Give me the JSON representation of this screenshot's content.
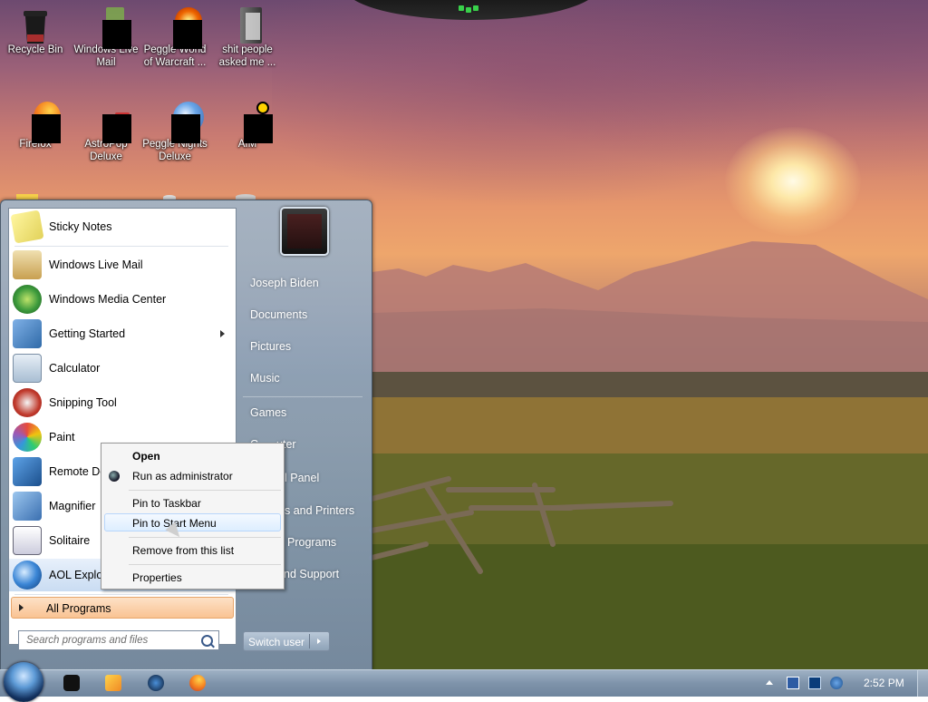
{
  "desktop": {
    "icons": [
      {
        "label": "Recycle Bin",
        "icon": "recycle-bin-icon"
      },
      {
        "label": "Windows Live Mail",
        "icon": "windows-live-mail-icon"
      },
      {
        "label": "Peggle World of Warcraft ...",
        "icon": "peggle-icon"
      },
      {
        "label": "shit people asked me ...",
        "icon": "folder-icon"
      },
      {
        "label": "Firefox",
        "icon": "firefox-icon"
      },
      {
        "label": "AstroPop Deluxe",
        "icon": "astropop-icon"
      },
      {
        "label": "Peggle Nights Deluxe",
        "icon": "peggle-nights-icon"
      },
      {
        "label": "AIM",
        "icon": "aim-icon"
      }
    ]
  },
  "start_menu": {
    "pinned": [
      {
        "label": "Sticky Notes",
        "icon": "sticky-notes-icon"
      }
    ],
    "recent": [
      {
        "label": "Windows Live Mail",
        "icon": "mail-icon"
      },
      {
        "label": "Windows Media Center",
        "icon": "media-center-icon"
      },
      {
        "label": "Getting Started",
        "icon": "getting-started-icon",
        "submenu": true
      },
      {
        "label": "Calculator",
        "icon": "calculator-icon"
      },
      {
        "label": "Snipping Tool",
        "icon": "snipping-tool-icon"
      },
      {
        "label": "Paint",
        "icon": "paint-icon"
      },
      {
        "label": "Remote Des",
        "icon": "remote-desktop-icon"
      },
      {
        "label": "Magnifier",
        "icon": "magnifier-icon"
      },
      {
        "label": "Solitaire",
        "icon": "solitaire-icon"
      },
      {
        "label": "AOL Explore",
        "icon": "aol-explorer-icon"
      }
    ],
    "all_programs": "All Programs",
    "search_placeholder": "Search programs and files",
    "right_items": [
      "Joseph Biden",
      "Documents",
      "Pictures",
      "Music",
      "Games",
      "Computer",
      "Control Panel",
      "Devices and Printers",
      "Default Programs",
      "Help and Support"
    ],
    "right_visible": [
      "Joseph Biden",
      "Documents",
      "Pictures",
      "Music",
      "Games",
      "C",
      "uter",
      "l Panel",
      "s and Printers",
      "Programs",
      "nd Support"
    ],
    "switch_user": "Switch user"
  },
  "context_menu": {
    "items": [
      {
        "label": "Open",
        "bold": true
      },
      {
        "label": "Run as administrator",
        "icon": "uac-shield-icon"
      },
      {
        "label": "Pin to Taskbar"
      },
      {
        "label": "Pin to Start Menu",
        "highlighted": true
      },
      {
        "label": "Remove from this list"
      },
      {
        "label": "Properties"
      }
    ]
  },
  "taskbar": {
    "pinned": [
      "app-icon",
      "media-player-icon",
      "aol-icon",
      "firefox-icon"
    ],
    "tray": [
      "show-hidden-icons-icon",
      "network-icon",
      "display-icon",
      "volume-icon"
    ],
    "clock": "2:52 PM"
  },
  "colors": {
    "accent_orange": "#f9c393",
    "highlight_blue": "#ddeeff",
    "taskbar": "#7e93aa"
  }
}
